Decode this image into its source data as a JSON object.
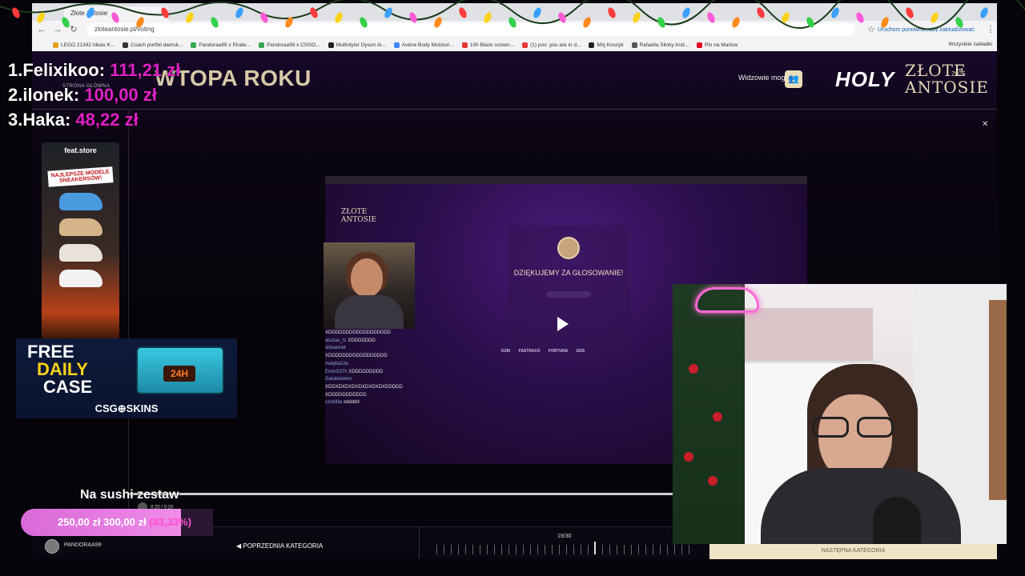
{
  "browser": {
    "tabs": [
      "Złote Antosie"
    ],
    "url": "zloteantosie.pl/voting",
    "update_hint": "Uruchom ponownie, aby zaktualizować",
    "bookmarks": [
      {
        "label": "LEGO 21342 Ideas K...",
        "color": "#e0a020"
      },
      {
        "label": "Coach portfel damsk...",
        "color": "#333333"
      },
      {
        "label": "Pandoraa99 x Pirate...",
        "color": "#36a852"
      },
      {
        "label": "Pandoraa99 x CSGO...",
        "color": "#36a852"
      },
      {
        "label": "Multistyler Dyson Ai...",
        "color": "#222222"
      },
      {
        "label": "Avène Body Moisturi...",
        "color": "#4285f4"
      },
      {
        "label": "10h Black screen...",
        "color": "#e53935"
      },
      {
        "label": "(1) pov: you are in d...",
        "color": "#e53935"
      },
      {
        "label": "Mój Koszyk",
        "color": "#222222"
      },
      {
        "label": "Rafaella Slinky And...",
        "color": "#555555"
      },
      {
        "label": "Pin na Marlow",
        "color": "#e60023"
      }
    ],
    "all_bookmarks": "Wszystkie zakładki"
  },
  "leaderboard": [
    {
      "name": "1.Felixikoo:",
      "amount": "111,21 zł"
    },
    {
      "name": "2.ilonek:",
      "amount": "100,00 zł"
    },
    {
      "name": "3.Haka:",
      "amount": "48,22 zł"
    }
  ],
  "site": {
    "back_link": "STRONA GŁÓWNA",
    "heading": "WTOPA ROKU",
    "viewers_label": "Widzowie mogą",
    "holy_logo": "HOLY",
    "zlote_line1": "ZŁOTE",
    "zlote_line2": "ANTOSIE",
    "zlote_year": "2025"
  },
  "ads": {
    "sneakers_brand": "feat.store",
    "sneakers_tag": "NAJLEPSZE MODELE SNEAKERSÓW!",
    "case_line1": "FREE",
    "case_line2": "DAILY",
    "case_line3": "CASE",
    "case_display": "24H",
    "case_logo": "CSG⊕SKINS"
  },
  "embed": {
    "logo_line1": "ZŁOTE",
    "logo_line2": "ANTOSIE",
    "thanks": "DZIĘKUJEMY ZA GŁOSOWANIE!",
    "sponsors": [
      "DZIK",
      "FASTRACK",
      "FORTUNA",
      "GDS"
    ],
    "chat": [
      {
        "user": "",
        "text": "XDDDDDDDDDDDDDDDDDD"
      },
      {
        "user": "aluzias_tz",
        "text": "XDDDDDDD"
      },
      {
        "user": "shivannet",
        "text": ""
      },
      {
        "user": "",
        "text": "XDDDDDDDDDDDDDDDDD"
      },
      {
        "user": "matylla22e",
        "text": ""
      },
      {
        "user": "EminS37h",
        "text": "XDDDDDDDDD"
      },
      {
        "user": "Gatolestemc",
        "text": ""
      },
      {
        "user": "",
        "text": "XDDXDXDXDXDXDXDXDXDDDDD"
      },
      {
        "user": "",
        "text": "XDDDDDDDDDDD"
      },
      {
        "user": "czubilila",
        "text": "xddddd"
      }
    ]
  },
  "bottom_bar": {
    "username": "PANDORAA99",
    "prev_category": "◀ POPRZEDNIA KATEGORIA",
    "counter": "19/30",
    "next_category": "NASTĘPNA KATEGORIA"
  },
  "goal": {
    "title": "Na sushi zestaw",
    "current": "250,00 zł",
    "target": "300,00 zł",
    "percent_text": "(83,33%)",
    "progress": 0.8333,
    "player_time": "0:20 / 0:20"
  }
}
